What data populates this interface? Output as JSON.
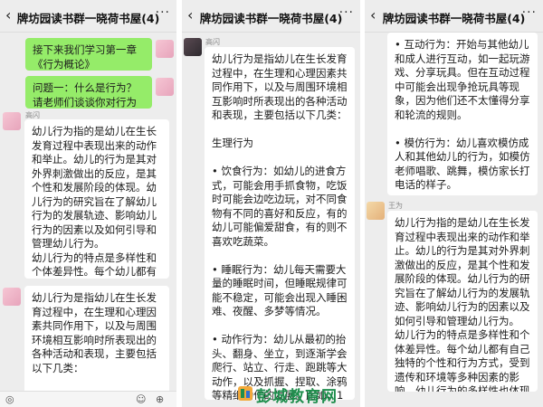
{
  "panels": [
    {
      "title": "牌坊园读书群一晓荷书屋(4)",
      "messages": [
        {
          "type": "self",
          "text": "接下来我们学习第一章《行为概论》"
        },
        {
          "type": "self",
          "text": "问题一：什么是行为？请老师们谈谈你对行为的理解"
        },
        {
          "type": "other",
          "sender": "高闪",
          "avatar": "pink",
          "text": "幼儿行为指的是幼儿在生长发育过程中表现出来的动作和举止。幼儿的行为是其对外界刺激做出的反应，是其个性和发展阶段的体现。幼儿行为的研究旨在了解幼儿行为的发展轨迹、影响幼儿行为的因素以及如何引导和管理幼儿行为。\n幼儿行为的特点是多样性和个体差异性。每个幼儿都有自己独特的个性和行为方式，受到遗传和环境等多种因素的影响。幼儿行为的多样性也体现在不同年龄阶段的幼儿之间会表现出不同的行为特征，随着幼儿的成长和发展，其行为也会发生变化。"
        },
        {
          "type": "other",
          "sender": "",
          "avatar": "pink",
          "text": "幼儿行为是指幼儿在生长发育过程中，在生理和心理因素共同作用下，以及与周围环境相互影响时所表现出的各种活动和表现，主要包括以下几类：\n\n生理行为"
        }
      ]
    },
    {
      "title": "牌坊园读书群一晓荷书屋(4)",
      "messages": [
        {
          "type": "other",
          "sender": "高闪",
          "avatar": "dark",
          "text": "幼儿行为是指幼儿在生长发育过程中，在生理和心理因素共同作用下，以及与周围环境相互影响时所表现出的各种活动和表现，主要包括以下几类：\n\n生理行为\n\n• 饮食行为：如幼儿的进食方式，可能会用手抓食物，吃饭时可能会边吃边玩，对不同食物有不同的喜好和反应，有的幼儿可能偏爱甜食，有的则不喜欢吃蔬菜。\n\n• 睡眠行为：幼儿每天需要大量的睡眠时间，但睡眠规律可能不稳定，可能会出现入睡困难、夜醒、多梦等情况。\n\n• 动作行为：幼儿从最初的抬头、翻身、坐立，到逐渐学会爬行、站立、行走、跑跳等大动作，以及抓握、捏取、涂鸦等精细动作的发展。比如，1岁左右的幼儿开始学走路，可能走得不稳，容易摔倒。\n\n认知行为\n\n• 探索行为：幼儿对周围世界充满好奇，会通过观察、触摸、品尝、摆弄等方式来探索物体"
        }
      ]
    },
    {
      "title": "牌坊园读书群一晓荷书屋(4)",
      "messages": [
        {
          "type": "other",
          "sender": "",
          "avatar": "",
          "text": "• 互动行为：开始与其他幼儿和成人进行互动，如一起玩游戏、分享玩具。但在互动过程中可能会出现争抢玩具等现象，因为他们还不太懂得分享和轮流的规则。\n\n• 模仿行为：幼儿喜欢模仿成人和其他幼儿的行为，如模仿老师唱歌、跳舞，模仿家长打电话的样子。\n\n• 合作行为：在幼儿园等集体环境中，逐渐学会与他人合作完成一些任务，如一起搭建积木城堡。"
        },
        {
          "type": "other",
          "sender": "王为",
          "avatar": "kid",
          "text": "幼儿行为指的是幼儿在生长发育过程中表现出来的动作和举止。幼儿的行为是其对外界刺激做出的反应，是其个性和发展阶段的体现。幼儿行为的研究旨在了解幼儿行为的发展轨迹、影响幼儿行为的因素以及如何引导和管理幼儿行为。\n幼儿行为的特点是多样性和个体差异性。每个幼儿都有自己独特的个性和行为方式，受到遗传和环境等多种因素的影响。幼儿行为的多样性也体现在不同年龄阶段的幼儿之间会表现出不同的行为特征，随着幼儿的成长和发展，其行为也会发生变化。"
        }
      ]
    }
  ],
  "watermark": "彭城教育网",
  "colors": {
    "self_bubble": "#95ec69",
    "other_bubble": "#ffffff",
    "background": "#ededed",
    "watermark": "#1f8e4d"
  }
}
